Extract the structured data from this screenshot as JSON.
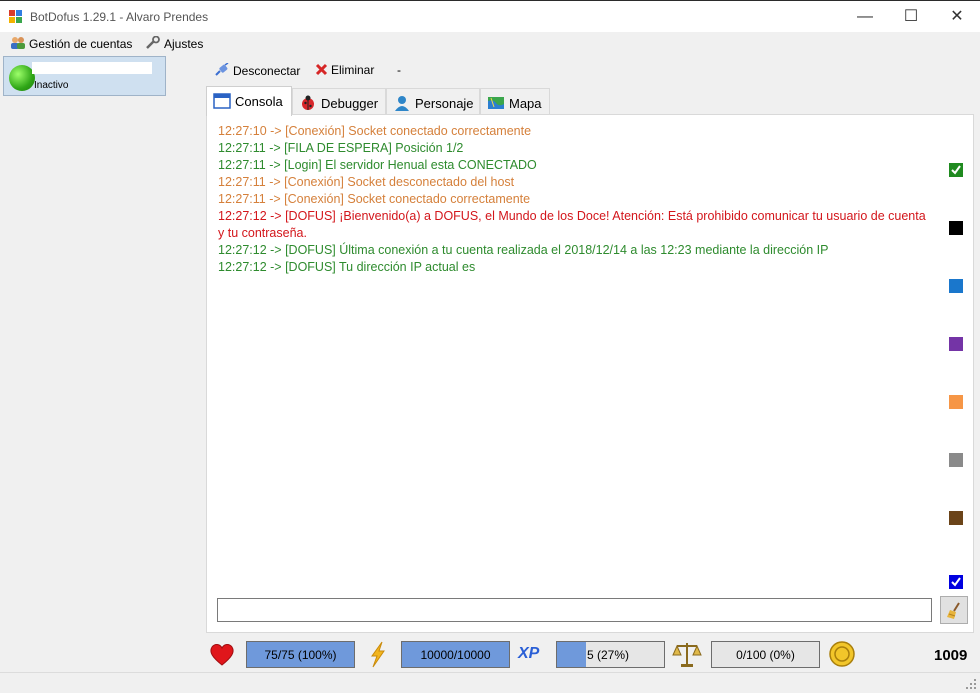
{
  "window": {
    "title": "BotDofus 1.29.1 - Alvaro Prendes",
    "minimize": "—",
    "maximize": "☐",
    "close": "✕"
  },
  "menu": {
    "accounts_label": "Gestión de cuentas",
    "settings_label": "Ajustes"
  },
  "account": {
    "status": "Inactivo"
  },
  "toolbar": {
    "disconnect_label": "Desconectar",
    "delete_label": "Eliminar",
    "extra_label": "-"
  },
  "tabs": [
    {
      "label": "Consola",
      "icon": "console-window-icon"
    },
    {
      "label": "Debugger",
      "icon": "ladybug-icon"
    },
    {
      "label": "Personaje",
      "icon": "character-icon"
    },
    {
      "label": "Mapa",
      "icon": "map-icon"
    }
  ],
  "console": {
    "lines": [
      {
        "text": "12:27:10 -> [Conexión] Socket conectado correctamente",
        "color": "#d5803b"
      },
      {
        "text": "12:27:11 -> [FILA DE ESPERA] Posición 1/2",
        "color": "#2e8b2e"
      },
      {
        "text": "12:27:11 -> [Login] El servidor Henual esta CONECTADO",
        "color": "#2e8b2e"
      },
      {
        "text": "12:27:11 -> [Conexión] Socket desconectado del host",
        "color": "#d5803b"
      },
      {
        "text": "12:27:11 -> [Conexión] Socket conectado correctamente",
        "color": "#d5803b"
      },
      {
        "text": "12:27:12 -> [DOFUS] ¡Bienvenido(a) a DOFUS, el Mundo de los Doce! Atención: Está prohibido comunicar tu usuario de cuenta y tu contraseña.",
        "color": "#d3161b"
      },
      {
        "text": "12:27:12 -> [DOFUS] Última conexión a tu cuenta realizada el 2018/12/14 a las 12:23 mediante la dirección IP",
        "color": "#2e8b2e"
      },
      {
        "text": "12:27:12 -> [DOFUS] Tu dirección IP actual es",
        "color": "#2e8b2e"
      }
    ],
    "input_value": "",
    "color_filters": [
      {
        "name": "green-filter",
        "color": "#1f8a1f",
        "checked": true
      },
      {
        "name": "black-filter",
        "color": "#000000",
        "checked": false
      },
      {
        "name": "blue-filter",
        "color": "#1a77cc",
        "checked": false
      },
      {
        "name": "purple-filter",
        "color": "#7434a6",
        "checked": false
      },
      {
        "name": "orange-filter",
        "color": "#f69646",
        "checked": false
      },
      {
        "name": "gray-filter",
        "color": "#8a8a8a",
        "checked": false
      },
      {
        "name": "brown-filter",
        "color": "#6b4419",
        "checked": false
      },
      {
        "name": "navy-filter",
        "color": "#0000e0",
        "checked": true
      }
    ]
  },
  "stats": {
    "health": {
      "text": "75/75 (100%)",
      "fraction": 1.0,
      "icon": "heart-icon"
    },
    "energy": {
      "text": "10000/10000",
      "fraction": 1.0,
      "icon": "lightning-icon"
    },
    "experience": {
      "text": "5 (27%)",
      "fraction": 0.27,
      "icon": "xp-icon",
      "icon_label": "XP"
    },
    "pods": {
      "text": "0/100 (0%)",
      "fraction": 0.0,
      "icon": "scale-icon"
    },
    "kamas": {
      "value": "1009",
      "icon": "kamas-coin-icon"
    }
  }
}
